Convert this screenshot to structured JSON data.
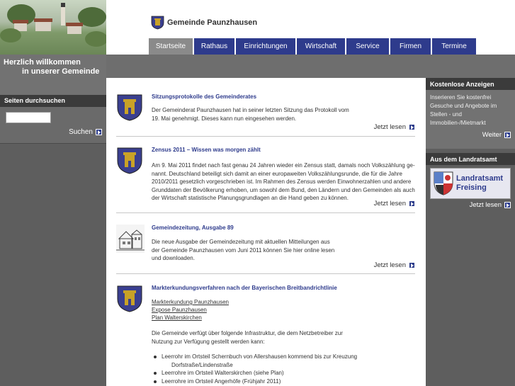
{
  "site": {
    "name": "Gemeinde Paunzhausen",
    "welcome_line1": "Herzlich willkommen",
    "welcome_line2": "in unserer Gemeinde"
  },
  "nav": [
    {
      "label": "Startseite",
      "active": true,
      "w": 62
    },
    {
      "label": "Rathaus",
      "active": false,
      "w": 57
    },
    {
      "label": "Einrichtungen",
      "active": false,
      "w": 84
    },
    {
      "label": "Wirtschaft",
      "active": false,
      "w": 68
    },
    {
      "label": "Service",
      "active": false,
      "w": 60
    },
    {
      "label": "Firmen",
      "active": false,
      "w": 57
    },
    {
      "label": "Termine",
      "active": false,
      "w": 62
    }
  ],
  "search": {
    "heading": "Seiten durchsuchen",
    "placeholder": "",
    "link": "Suchen"
  },
  "sidebar": {
    "ads_heading": "Kostenlose Anzeigen",
    "ads_text": "Inserieren Sie kostenfrei Gesuche und Angebote im Stellen - und Immobilien-/Mietmarkt",
    "ads_link": "Weiter",
    "lra_heading": "Aus dem Landratsamt",
    "lra_line1": "Landratsamt",
    "lra_line2": "Freising",
    "lra_link": "Jetzt lesen"
  },
  "articles": [
    {
      "title": "Sitzungsprotokolle des Gemeinderates",
      "text": "Der Gemeinderat Paunzhausen hat in seiner letzten Sitzung das Protokoll vom 19. Mai genehmigt. Dieses kann nun eingesehen werden.",
      "more": "Jetzt lesen"
    },
    {
      "title": "Zensus 2011 – Wissen was morgen zählt",
      "text": "Am 9. Mai 2011 findet nach fast genau 24 Jahren wieder ein Zensus statt, damals noch Volkszählung ge-nannt. Deutschland beteiligt sich damit an einer europaweiten Volkszählungsrunde, die für die Jahre 2010/2011 gesetzlich vorgeschrieben ist. Im Rahmen des Zensus werden Einwohnerzahlen und andere Grunddaten der Bevölkerung erhoben, um sowohl dem Bund, den Ländern und den Gemeinden als auch der Wirtschaft statistische Planungsgrundlagen an die Hand geben zu können.",
      "more": "Jetzt lesen"
    },
    {
      "title": "Gemeindezeitung, Ausgabe 89",
      "text": "Die neue Ausgabe der Gemeindezeitung mit aktuellen Mitteilungen aus der Gemeinde Paunzhausen vom Juni 2011 können Sie hier online lesen und downloaden.",
      "more": "Jetzt lesen"
    },
    {
      "title": "Markterkundungsverfahren nach der Bayerischen Breitbandrichtlinie",
      "links": [
        "Markterkundung Paunzhausen",
        "Expose Paunzhausen",
        "Plan Walterskirchen"
      ],
      "text": "Die Gemeinde verfügt über folgende Infrastruktur, die dem Netzbetreiber zur Nutzung zur Verfügung gestellt werden kann:",
      "bullets": [
        {
          "text": "Leerrohr im Ortsteil Schernbuch von Allershausen kommend bis zur Kreuzung",
          "sub": "Dorfstraße/Lindenstraße"
        },
        {
          "text": "Leerrohre im Ortsteil Walterskirchen (siehe Plan)"
        },
        {
          "text": "Leerrohre im Ortsteil Angerhöfe (Frühjahr 2011)"
        }
      ]
    }
  ]
}
